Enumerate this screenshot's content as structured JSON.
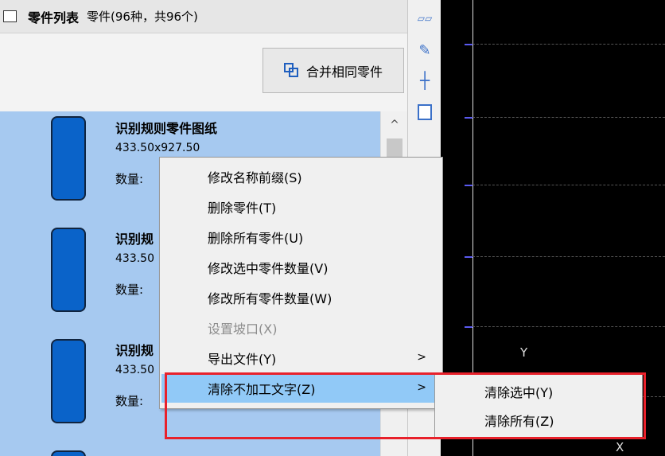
{
  "header": {
    "title": "零件列表",
    "subtitle": "零件(96种，共96个)"
  },
  "toolbar": {
    "merge_label": "合并相同零件"
  },
  "parts": [
    {
      "name": "识别规则零件图纸",
      "size": "433.50x927.50",
      "qty_label": "数量:"
    },
    {
      "name": "识别规",
      "size": "433.50",
      "qty_label": "数量:"
    },
    {
      "name": "识别规",
      "size": "433.50",
      "qty_label": "数量:"
    }
  ],
  "scroll": {
    "up_glyph": "^"
  },
  "context_menu": {
    "items": [
      {
        "label": "修改名称前缀(S)"
      },
      {
        "label": "删除零件(T)"
      },
      {
        "label": "删除所有零件(U)"
      },
      {
        "label": "修改选中零件数量(V)"
      },
      {
        "label": "修改所有零件数量(W)"
      },
      {
        "label": "设置坡口(X)"
      },
      {
        "label": "导出文件(Y)"
      },
      {
        "label": "清除不加工文字(Z)"
      }
    ],
    "arrow": ">"
  },
  "submenu": {
    "items": [
      {
        "label": "清除选中(Y)"
      },
      {
        "label": "清除所有(Z)"
      }
    ]
  },
  "canvas": {
    "y_label": "Y",
    "x_label": "X"
  },
  "icons": {
    "tool1": "aspect-ratio-icon",
    "tool2": "magic-wand-icon",
    "tool3": "crosshair-icon",
    "tool4": "page-icon"
  },
  "colors": {
    "selection": "#a6c9f0",
    "part_fill": "#0a63c9",
    "menu_highlight": "#91c9f7",
    "annotation_box": "#e8212b"
  }
}
